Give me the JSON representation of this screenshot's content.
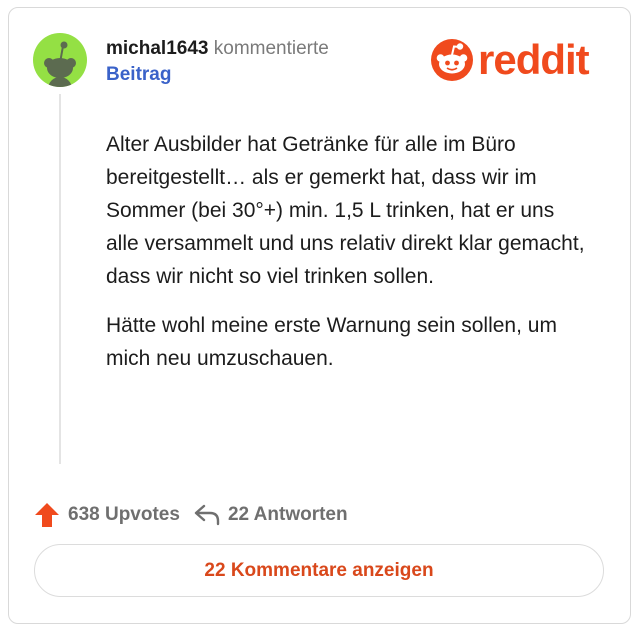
{
  "comment": {
    "username": "michal1643",
    "action": "kommentierte",
    "post_link": "Beitrag",
    "paragraphs": [
      "Alter Ausbilder hat Getränke für alle im Büro bereitgestellt… als er gemerkt hat, dass wir im Sommer (bei 30°+) min. 1,5 L trinken, hat er uns alle versammelt und uns relativ direkt klar gemacht, dass wir nicht so viel trinken sollen.",
      "Hätte wohl meine erste Warnung sein sollen, um mich neu umzuschauen."
    ]
  },
  "logo": {
    "text": "reddit",
    "icon": "reddit-snoo-icon"
  },
  "footer": {
    "upvotes_label": "638 Upvotes",
    "replies_label": "22 Antworten",
    "upvote_icon": "upvote-arrow-icon",
    "reply_icon": "reply-arrow-icon"
  },
  "view_comments_label": "22 Kommentare anzeigen",
  "colors": {
    "accent": "#f04a1d",
    "link": "#3a62c9",
    "avatar_bg": "#94e044",
    "muted": "#6f6f6f"
  }
}
